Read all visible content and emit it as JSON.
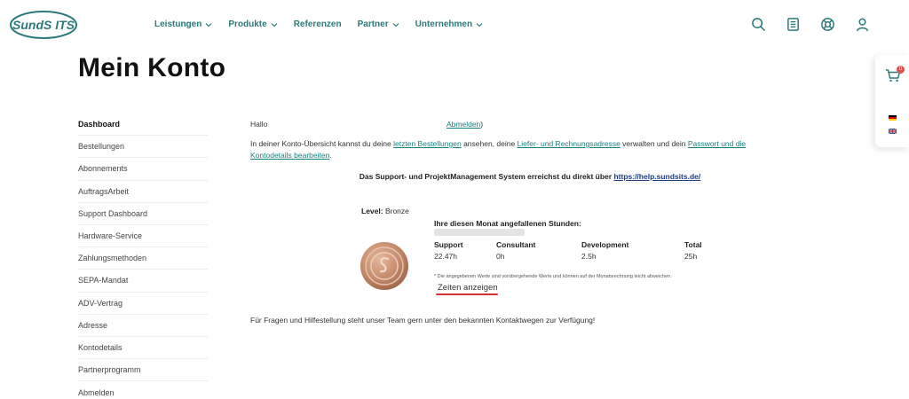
{
  "header": {
    "logo_text": "SundS ITS",
    "nav": [
      {
        "label": "Leistungen",
        "has_dropdown": true
      },
      {
        "label": "Produkte",
        "has_dropdown": true
      },
      {
        "label": "Referenzen",
        "has_dropdown": false
      },
      {
        "label": "Partner",
        "has_dropdown": true
      },
      {
        "label": "Unternehmen",
        "has_dropdown": true
      }
    ],
    "icons": [
      "search-icon",
      "document-icon",
      "support-lifebuoy-icon",
      "user-icon"
    ],
    "accent_color": "#2b7a7a"
  },
  "page": {
    "title": "Mein Konto"
  },
  "side_panel": {
    "cart_count": "0",
    "flags": [
      "de-flag-icon",
      "uk-flag-icon"
    ]
  },
  "sidebar": {
    "items": [
      {
        "label": "Dashboard",
        "active": true
      },
      {
        "label": "Bestellungen"
      },
      {
        "label": "Abonnements"
      },
      {
        "label": "AuftragsArbeit"
      },
      {
        "label": "Support Dashboard"
      },
      {
        "label": "Hardware-Service"
      },
      {
        "label": "Zahlungsmethoden"
      },
      {
        "label": "SEPA-Mandat"
      },
      {
        "label": "ADV-Vertrag"
      },
      {
        "label": "Adresse"
      },
      {
        "label": "Kontodetails"
      },
      {
        "label": "Partnerprogramm"
      },
      {
        "label": "Abmelden"
      }
    ]
  },
  "main": {
    "hello": "Hallo",
    "logout_link": "Abmelden",
    "logout_suffix": ")",
    "intro": {
      "t1": "In deiner Konto-Übersicht kannst du deine ",
      "l1": "letzten Bestellungen",
      "t2": " ansehen, deine ",
      "l2": "Liefer- und Rechnungsadresse",
      "t3": " verwalten und dein ",
      "l3": "Passwort und die Kontodetails bearbeiten",
      "t4": "."
    },
    "support_text": "Das Support- und ProjektManagement System erreichst du direkt über",
    "support_link": "https://help.sundsits.de/",
    "level_label": "Level:",
    "level_value": "Bronze",
    "hours_title": "Ihre diesen Monat angefallenen Stunden:",
    "hours": [
      {
        "label": "Support",
        "value": "22.47h"
      },
      {
        "label": "Consultant",
        "value": "0h"
      },
      {
        "label": "Development",
        "value": "2.5h"
      },
      {
        "label": "Total",
        "value": "25h"
      }
    ],
    "disclaimer": "* Die angegebenen Werte sind vorübergehende Werte und können auf der Monatsrechnung leicht abweichen.",
    "show_times_button": "Zeiten anzeigen",
    "footer_note": "Für Fragen und Hilfestellung steht unser Team gern unter den bekannten Kontaktwegen zur Verfügung!"
  }
}
